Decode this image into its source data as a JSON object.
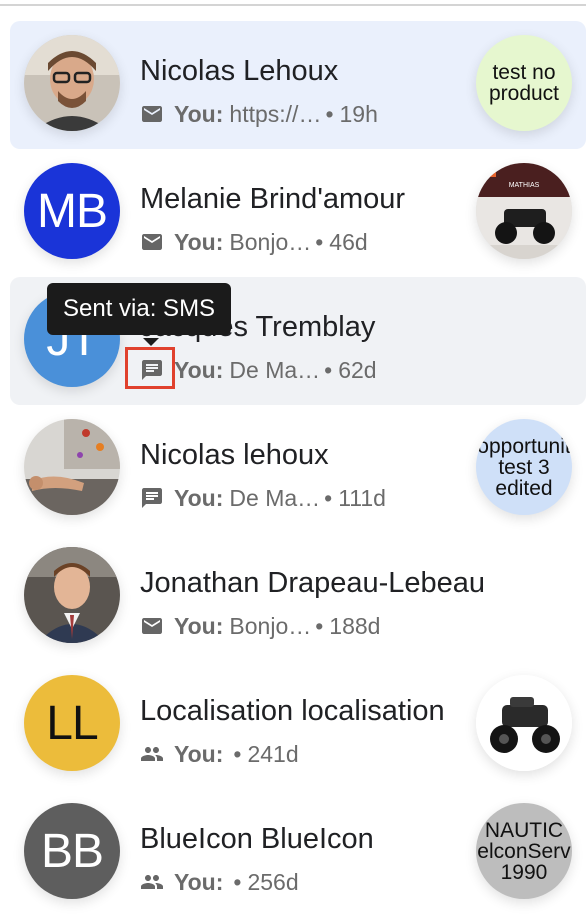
{
  "colors": {
    "selected_row_bg": "#eaf0fc",
    "hover_row_bg": "#f0f2f5",
    "tooltip_bg": "#1b1b1b",
    "highlight_border": "#e0412d",
    "avatar_mb": "#1a34d8",
    "avatar_jt": "#4a90d9",
    "avatar_ll": "#ecbc3b",
    "avatar_bb": "#5e5e5e",
    "thumb_test_no_product": "#e6f7cf",
    "thumb_opportunity": "#cfe0f8",
    "thumb_nautic": "#bdbdbd"
  },
  "tooltip": {
    "text": "Sent via: SMS"
  },
  "conversations": [
    {
      "name": "Nicolas Lehoux",
      "channel_icon": "email-icon",
      "you_label": "You:",
      "preview": "https://…",
      "separator": "•",
      "time": "19h",
      "avatar_type": "photo",
      "product_label_lines": [
        "test no",
        "product"
      ]
    },
    {
      "name": "Melanie Brind'amour",
      "channel_icon": "email-icon",
      "you_label": "You:",
      "preview": "Bonjo…",
      "separator": "•",
      "time": "46d",
      "avatar_initials": "MB",
      "product_type": "atv-photo",
      "product_brand": "MATHIAS"
    },
    {
      "name": "Jacques Tremblay",
      "channel_icon": "sms-icon",
      "you_label": "You:",
      "preview": "De Ma…",
      "separator": "•",
      "time": "62d",
      "avatar_initials": "JT"
    },
    {
      "name": "Nicolas lehoux",
      "channel_icon": "sms-icon",
      "you_label": "You:",
      "preview": "De Ma…",
      "separator": "•",
      "time": "111d",
      "avatar_type": "photo",
      "product_label_lines": [
        "opportunit",
        "test 3",
        "edited"
      ]
    },
    {
      "name": "Jonathan Drapeau-Lebeau",
      "channel_icon": "email-icon",
      "you_label": "You:",
      "preview": "Bonjo…",
      "separator": "•",
      "time": "188d",
      "avatar_type": "photo"
    },
    {
      "name": "Localisation localisation",
      "channel_icon": "group-icon",
      "you_label": "You:",
      "preview": "",
      "separator": "•",
      "time": "241d",
      "avatar_initials": "LL",
      "product_type": "atv-photo"
    },
    {
      "name": "BlueIcon BlueIcon",
      "channel_icon": "group-icon",
      "you_label": "You:",
      "preview": "",
      "separator": "•",
      "time": "256d",
      "avatar_initials": "BB",
      "product_label_lines": [
        "NAUTIC",
        "elconServ",
        "1990"
      ]
    }
  ]
}
